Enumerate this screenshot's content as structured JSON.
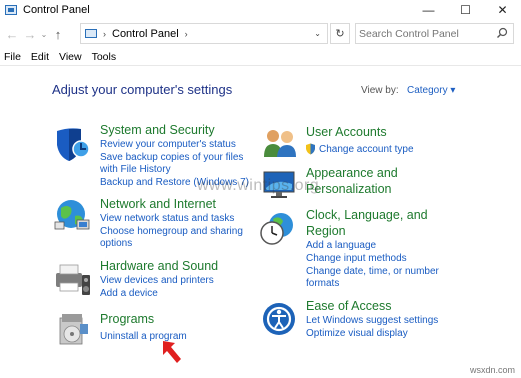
{
  "window": {
    "title": "Control Panel",
    "minimize_glyph": "—",
    "maximize_glyph": "☐",
    "close_glyph": "✕"
  },
  "nav": {
    "back_glyph": "←",
    "forward_glyph": "→",
    "recent_glyph": "⌄",
    "up_glyph": "↑",
    "breadcrumb_sep": "›",
    "breadcrumb": "Control Panel",
    "breadcrumb_trail_sep": "›",
    "address_dropdown_glyph": "⌄",
    "refresh_glyph": "↻",
    "search_placeholder": "Search Control Panel"
  },
  "menu": [
    "File",
    "Edit",
    "View",
    "Tools"
  ],
  "heading": "Adjust your computer's settings",
  "view_by": {
    "label": "View by:",
    "value": "Category ▾"
  },
  "categories": {
    "system": {
      "title": "System and Security",
      "links": [
        "Review your computer's status",
        "Save backup copies of your files",
        "with File History",
        "Backup and Restore (Windows 7)"
      ]
    },
    "network": {
      "title": "Network and Internet",
      "links": [
        "View network status and tasks",
        "Choose homegroup and sharing",
        "options"
      ]
    },
    "hardware": {
      "title": "Hardware and Sound",
      "links": [
        "View devices and printers",
        "Add a device"
      ]
    },
    "programs": {
      "title": "Programs",
      "links": [
        "Uninstall a program"
      ]
    },
    "users": {
      "title": "User Accounts",
      "links": [
        "Change account type"
      ]
    },
    "appearance": {
      "title_line1": "Appearance and",
      "title_line2": "Personalization"
    },
    "clock": {
      "title_line1": "Clock, Language, and",
      "title_line2": "Region",
      "links": [
        "Add a language",
        "Change input methods",
        "Change date, time, or number",
        "formats"
      ]
    },
    "ease": {
      "title": "Ease of Access",
      "links": [
        "Let Windows suggest settings",
        "Optimize visual display"
      ]
    }
  },
  "watermark": "www.wintips.org",
  "corner_mark": "wsxdn.com",
  "colors": {
    "heading": "#1e3287",
    "category_title": "#1e7a2e",
    "link": "#1a5cc2",
    "annotation_arrow": "#e02020"
  },
  "icons": {
    "system": "shield-icon",
    "network": "globe-network-icon",
    "hardware": "printer-icon",
    "programs": "programs-disc-icon",
    "users": "users-icon",
    "appearance": "display-icon",
    "clock": "clock-globe-icon",
    "ease": "ease-of-access-icon"
  }
}
